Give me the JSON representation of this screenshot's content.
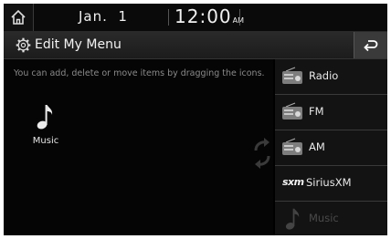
{
  "status": {
    "date": "Jan.  1",
    "time": "12:00",
    "ampm": "AM"
  },
  "header": {
    "title": "Edit My Menu"
  },
  "main": {
    "hint": "You can add, delete or move items by dragging the icons.",
    "selected_items": [
      {
        "label": "Music",
        "icon": "music-note-icon"
      }
    ]
  },
  "menu_list": [
    {
      "label": "Radio",
      "icon": "radio-icon",
      "enabled": true
    },
    {
      "label": "FM",
      "icon": "radio-icon",
      "enabled": true
    },
    {
      "label": "AM",
      "icon": "radio-icon",
      "enabled": true
    },
    {
      "label": "SiriusXM",
      "icon": "sxm-logo",
      "logo_text": "sxm",
      "enabled": true
    },
    {
      "label": "Music",
      "icon": "music-note-icon",
      "enabled": false
    }
  ],
  "colors": {
    "background": "#000000",
    "text": "#e8e8e8",
    "hint_text": "#8a8a8a",
    "disabled_text": "#4a4a4a"
  }
}
